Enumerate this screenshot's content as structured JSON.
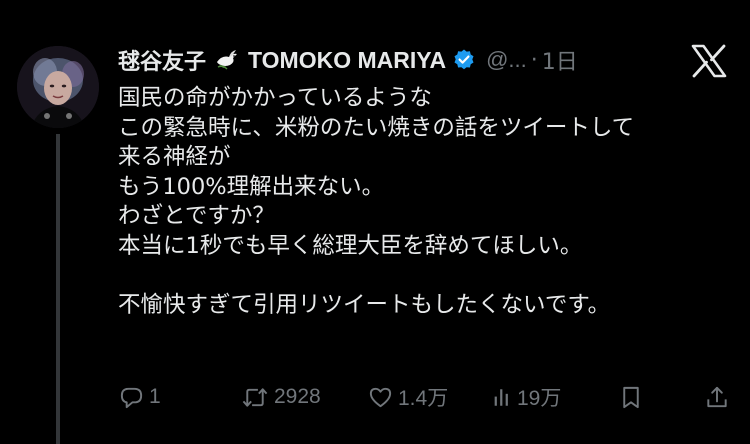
{
  "tweet": {
    "author": {
      "display_name": "毬谷友子",
      "english_name": "TOMOKO MARIYA",
      "handle": "@...",
      "separator": "·",
      "time": "1日",
      "avatar_icon": "profile-photo",
      "emoji_icon": "dove-with-olive-branch-icon",
      "badge_icon": "verified-badge-icon",
      "badge_color": "#1d9bf0"
    },
    "platform_icon": "x-logo-icon",
    "text_lines": [
      "国民の命がかかっているような",
      "この緊急時に、米粉のたい焼きの話をツイートして",
      "来る神経が",
      "もう100%理解出来ない。",
      "わざとですか？",
      "本当に1秒でも早く総理大臣を辞めてほしい。",
      "",
      "不愉快すぎて引用リツイートもしたくないです。"
    ],
    "actions": {
      "reply_count": "1",
      "retweet_count": "2928",
      "like_count": "1.4万",
      "views_count": "19万"
    }
  },
  "colors": {
    "background": "#000000",
    "text": "#e7e9ea",
    "muted": "#71767b",
    "thread_line": "#333639"
  }
}
